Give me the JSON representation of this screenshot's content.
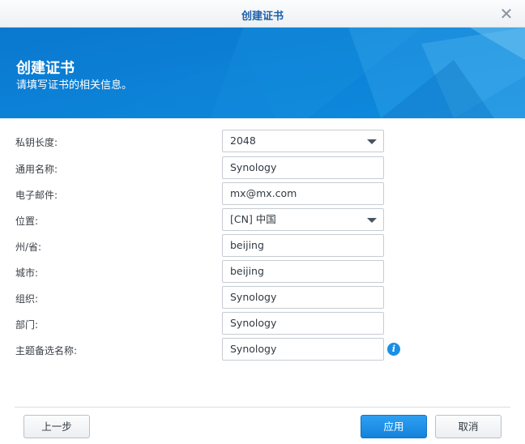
{
  "window": {
    "title": "创建证书"
  },
  "banner": {
    "title": "创建证书",
    "subtitle": "请填写证书的相关信息。"
  },
  "form": {
    "key_length": {
      "label": "私钥长度:",
      "value": "2048"
    },
    "common_name": {
      "label": "通用名称:",
      "value": "Synology"
    },
    "email": {
      "label": "电子邮件:",
      "value": "mx@mx.com"
    },
    "location": {
      "label": "位置:",
      "value": "[CN] 中国"
    },
    "state": {
      "label": "州/省:",
      "value": "beijing"
    },
    "city": {
      "label": "城市:",
      "value": "beijing"
    },
    "organization": {
      "label": "组织:",
      "value": "Synology"
    },
    "department": {
      "label": "部门:",
      "value": "Synology"
    },
    "subject_alt_name": {
      "label": "主题备选名称:",
      "value": "Synology"
    }
  },
  "footer": {
    "back_label": "上一步",
    "apply_label": "应用",
    "cancel_label": "取消"
  },
  "icons": {
    "close": "close-icon",
    "info": "info-icon",
    "dropdown": "chevron-down-icon"
  },
  "colors": {
    "accent": "#0d7fd4",
    "title": "#1f5fa8",
    "primary_button": "#1a8fe3"
  }
}
